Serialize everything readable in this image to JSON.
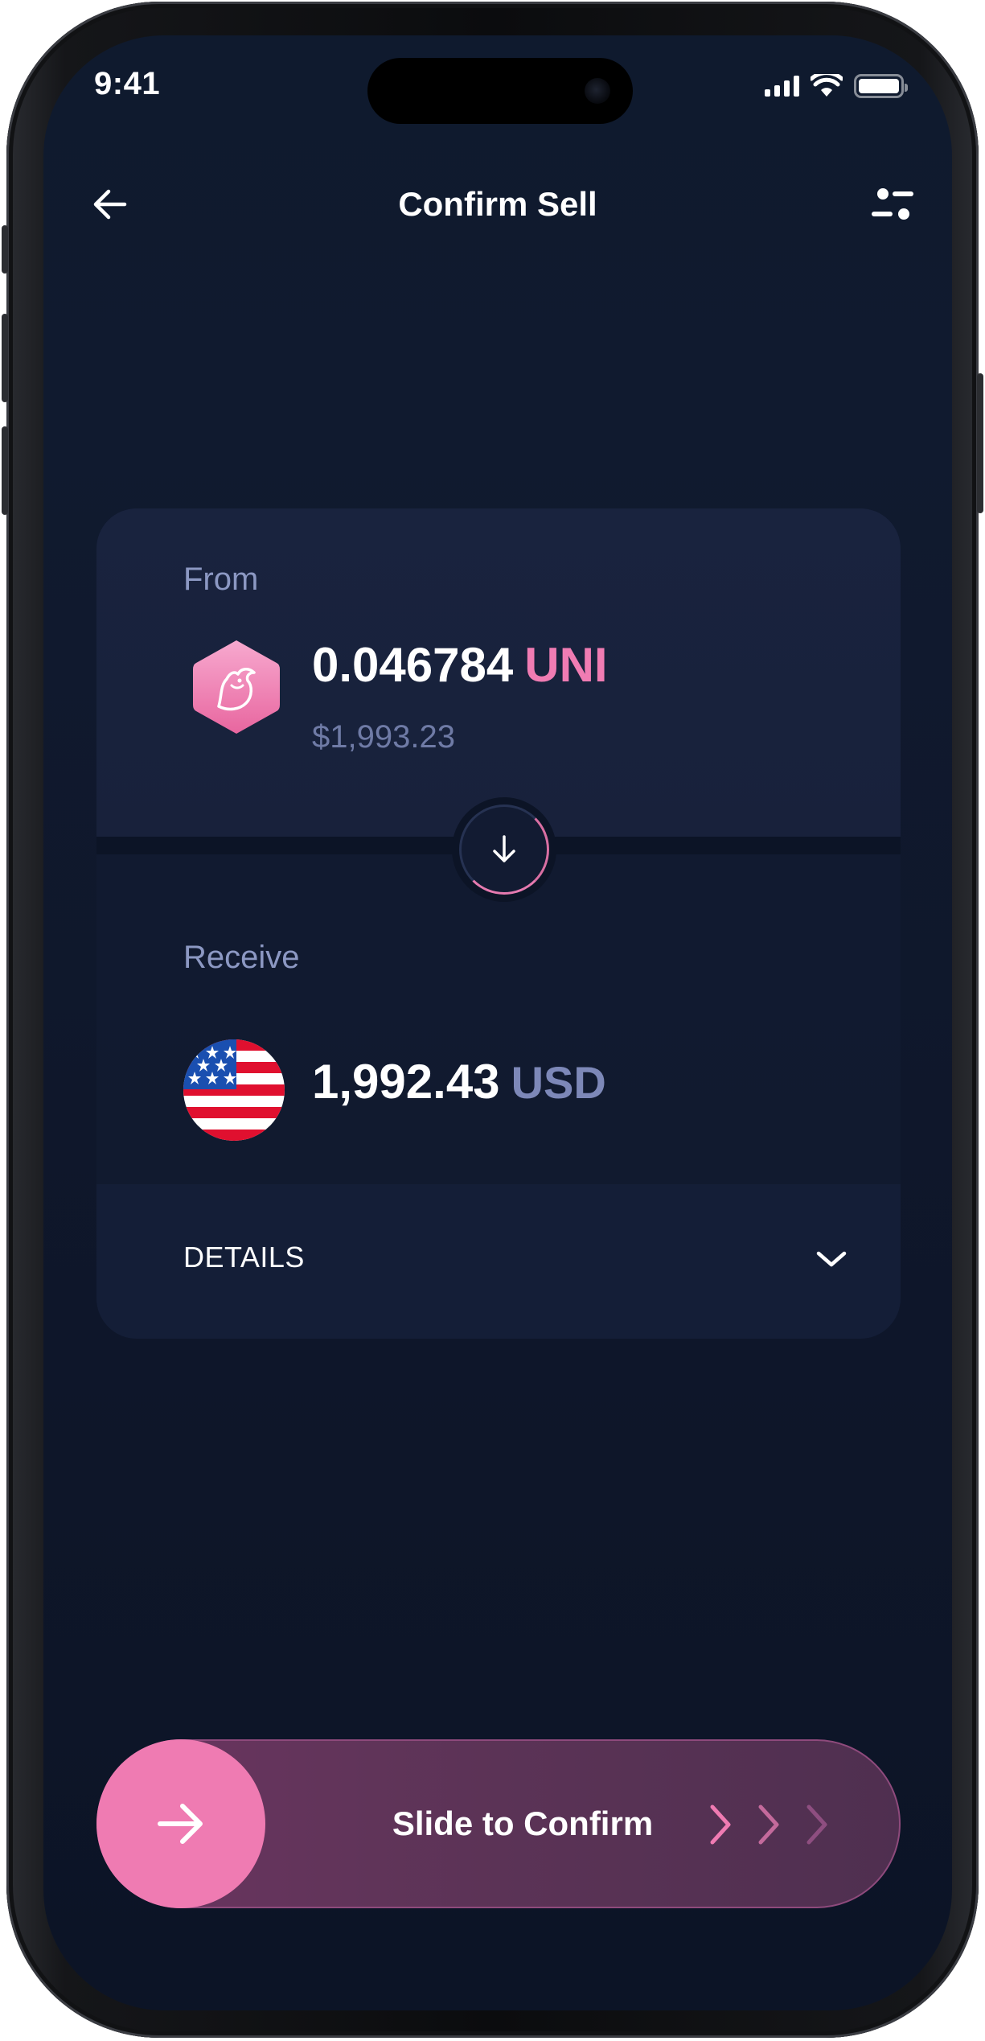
{
  "status_bar": {
    "time": "9:41"
  },
  "nav": {
    "title": "Confirm Sell"
  },
  "from": {
    "label": "From",
    "amount": "0.046784",
    "ticker": "UNI",
    "fiat_value": "$1,993.23"
  },
  "receive": {
    "label": "Receive",
    "amount": "1,992.43",
    "ticker": "USD"
  },
  "details": {
    "label": "DETAILS"
  },
  "slider": {
    "label": "Slide to Confirm"
  },
  "colors": {
    "accent_pink": "#ef7bb2",
    "background": "#0f172b",
    "card": "#18213b",
    "muted_text": "#8c98c3"
  },
  "icons": {
    "back": "arrow-left-icon",
    "filter": "filter-icon",
    "from_token": "uniswap-icon",
    "swap": "arrow-down-icon",
    "receive_token": "us-flag-icon",
    "details": "chevron-down-icon",
    "slider_knob": "arrow-right-icon"
  }
}
